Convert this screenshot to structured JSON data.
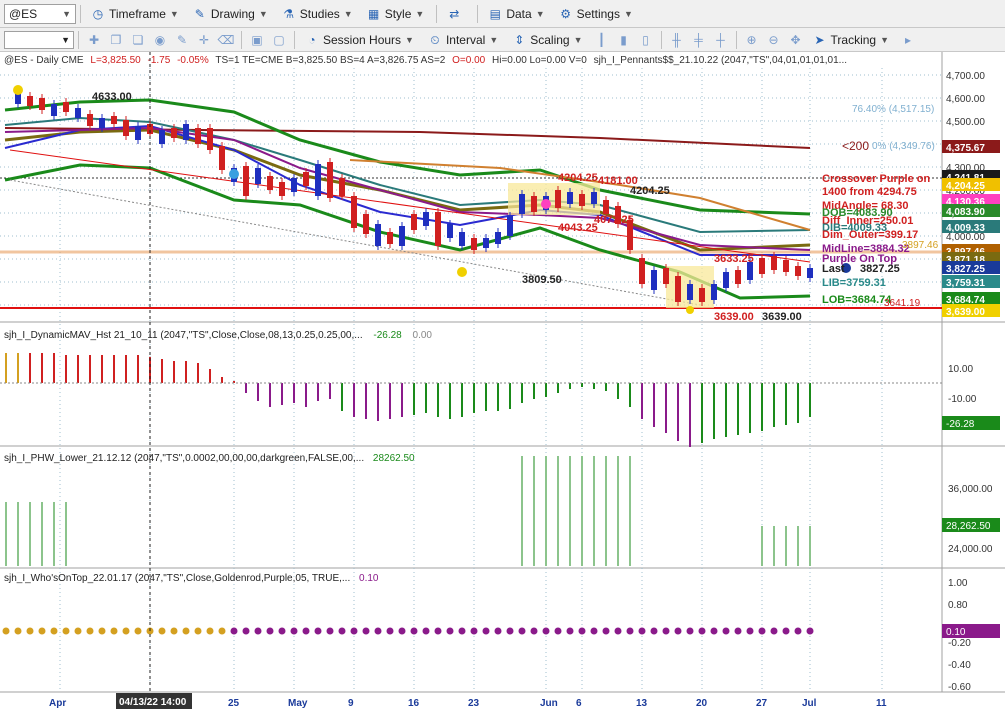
{
  "toolbar": {
    "symbol": "@ES",
    "items": [
      "Timeframe",
      "Drawing",
      "Studies",
      "Style",
      "Data",
      "Settings"
    ],
    "session_hours": "Session Hours",
    "interval": "Interval",
    "scaling": "Scaling",
    "tracking": "Tracking"
  },
  "header": {
    "symbol_info": "@ES - Daily  CME",
    "last": "L=3,825.50",
    "change": "-1.75",
    "change_pct": "-0.05%",
    "fields": "TS=1  TE=CME  B=3,825.50  BS=4  A=3,826.75  AS=2",
    "open": "O=0.00",
    "rest": "Hi=0.00  Lo=0.00  V=0",
    "study": "sjh_I_Pennants$$_21.10.22 (2047,\"TS\",04,01,01,01,01..."
  },
  "price_axis": {
    "ticks": [
      "4,700.00",
      "4,600.00",
      "4,500.00",
      "4,400.00",
      "4,300.00",
      "4,200.00",
      "4,100.00",
      "4,000.00",
      "3,900.00",
      "3,800.00",
      "3,700.00"
    ],
    "labels": [
      {
        "text": "4,375.67",
        "color": "#8b1a1a"
      },
      {
        "text": "4,241.81",
        "color": "#1a1a1a"
      },
      {
        "text": "4,204.25",
        "color": "#f0c000"
      },
      {
        "text": "4,130.36",
        "color": "#ff40c0"
      },
      {
        "text": "4,083.90",
        "color": "#2a8a2a"
      },
      {
        "text": "4,009.33",
        "color": "#2a7a7a"
      },
      {
        "text": "3,897.46",
        "color": "#b06000"
      },
      {
        "text": "3,871.18",
        "color": "#7a6a10"
      },
      {
        "text": "3,827.25",
        "color": "#1a3a9a"
      },
      {
        "text": "3,759.31",
        "color": "#2a8a8a"
      },
      {
        "text": "3,684.74",
        "color": "#1a8a1a"
      },
      {
        "text": "3,639.00",
        "color": "#f0d000"
      }
    ]
  },
  "annotations": {
    "top_left": "4633.00",
    "fib": "76.40% (4,517.15)",
    "fib2": "0% (4,349.76)",
    "lt200": "<200",
    "crossover1": "Crossover Purple on",
    "crossover2": "1400 from 4294.75",
    "midangle": "MidAngle= 68.30",
    "dob": "DOB=4083.90",
    "diff_inner": "Diff_Inner=250.01",
    "dib": "DIB=4009.33",
    "dim_outer": "Dim_Outer=399.17",
    "midline": "MidLine=3884.32",
    "purple_on_top": "Purple On Top",
    "last": "Last",
    "last_val": "3827.25",
    "lib": "LIB=3759.31",
    "lob": "LOB=3684.74",
    "peak": "4204.25",
    "p4204": "4204.25",
    "p4181": "4181.00",
    "p4077": "4077.25",
    "p4043": "4043.25",
    "p3809": "3809.50",
    "p3639a": "3639.00",
    "p3639b": "3639.00",
    "p3633": "3633.25",
    "p3641": "3641.19",
    "midline_val": "3897.46"
  },
  "panel1": {
    "title": "sjh_I_DynamicMAV_Hst 21_10_11 (2047,\"TS\",Close,Close,08,13,0.25,0.25,00,...",
    "v1": "-26.28",
    "v2": "0.00",
    "ticks": [
      "10.00",
      "-10.00"
    ],
    "label": "-26.28"
  },
  "panel2": {
    "title": "sjh_I_PHW_Lower_21.12.12 (2047,\"TS\",0.0002,00,00,00,darkgreen,FALSE,00,...",
    "v1": "28262.50",
    "ticks": [
      "36,000.00",
      "24,000.00"
    ],
    "label": "28,262.50"
  },
  "panel3": {
    "title": "sjh_I_Who'sOnTop_22.01.17 (2047,\"TS\",Close,Goldenrod,Purple,05, TRUE,...",
    "v1": "0.10",
    "ticks": [
      "1.00",
      "0.80",
      "0.60",
      "0.40",
      "0.20",
      "-0.20",
      "-0.40",
      "-0.60"
    ],
    "label": "0.10"
  },
  "time_axis": {
    "labels": [
      "Apr",
      "25",
      "May",
      "9",
      "16",
      "23",
      "Jun",
      "6",
      "13",
      "20",
      "27",
      "Jul",
      "11"
    ],
    "cursor": "04/13/22 14:00"
  },
  "colors": {
    "up": "#1f2fbf",
    "down": "#d02020",
    "green": "#1a8a1a",
    "purple": "#8a1a8a",
    "gold": "#d4a020"
  }
}
